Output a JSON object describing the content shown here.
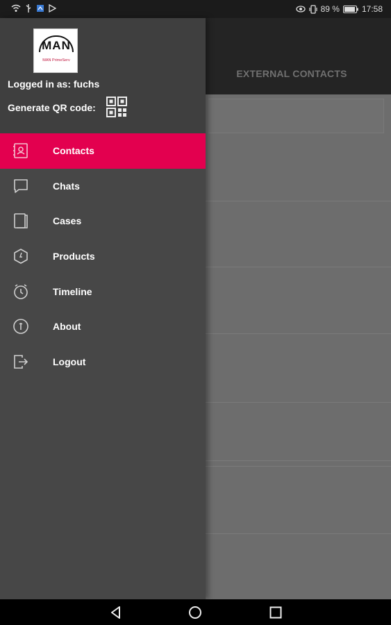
{
  "status_bar": {
    "battery_percent": "89 %",
    "time": "17:58",
    "left_icons": [
      "wifi-icon",
      "usb-icon",
      "sim-icon",
      "play-store-icon"
    ],
    "right_icons": [
      "eye-icon",
      "vibrate-icon",
      "battery-icon"
    ]
  },
  "background_app": {
    "tab_label": "EXTERNAL CONTACTS"
  },
  "drawer": {
    "logo": {
      "text": "MAN",
      "subtext": "MAN PrimeServ"
    },
    "logged_in_text": "Logged in as: fuchs",
    "qr_label": "Generate QR code:",
    "menu_items": [
      {
        "label": "Contacts",
        "icon": "contacts-icon",
        "active": true
      },
      {
        "label": "Chats",
        "icon": "chat-icon",
        "active": false
      },
      {
        "label": "Cases",
        "icon": "cases-icon",
        "active": false
      },
      {
        "label": "Products",
        "icon": "products-icon",
        "active": false
      },
      {
        "label": "Timeline",
        "icon": "timeline-icon",
        "active": false
      },
      {
        "label": "About",
        "icon": "about-icon",
        "active": false
      },
      {
        "label": "Logout",
        "icon": "logout-icon",
        "active": false
      }
    ],
    "accent_color": "#e3004f"
  },
  "nav_bar": {
    "buttons": [
      "back-icon",
      "home-icon",
      "recents-icon"
    ]
  }
}
